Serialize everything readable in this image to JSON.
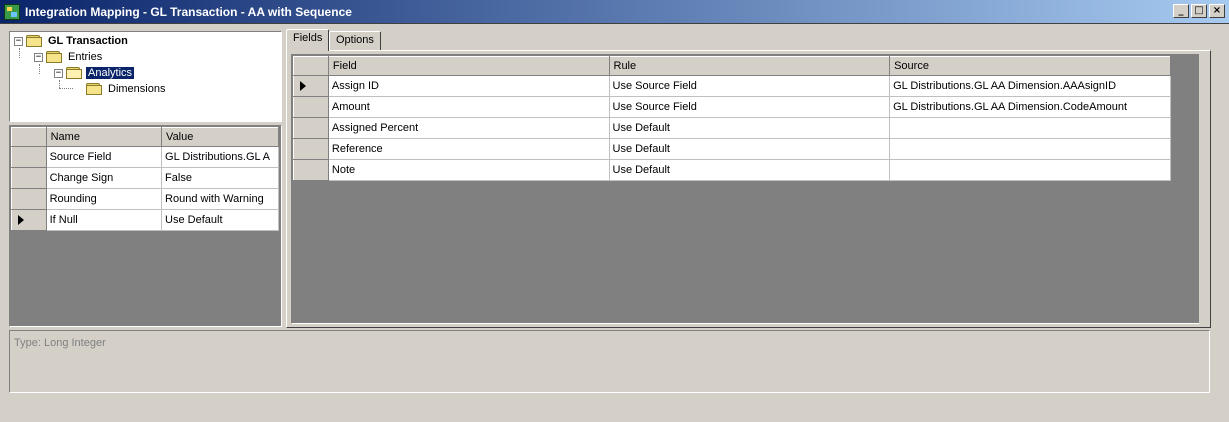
{
  "window": {
    "title": "Integration Mapping - GL Transaction - AA with Sequence",
    "minimize": "_",
    "maximize": "□",
    "close": "×"
  },
  "tree": {
    "items": [
      {
        "label": "GL Transaction",
        "icon": "folder-icon",
        "expanded": true
      },
      {
        "label": "Entries",
        "icon": "folder-icon",
        "expanded": true
      },
      {
        "label": "Analytics",
        "icon": "folder-open-icon",
        "expanded": true,
        "selected": true
      },
      {
        "label": "Dimensions",
        "icon": "folder-icon"
      }
    ]
  },
  "properties": {
    "columns": [
      "Name",
      "Value"
    ],
    "rows": [
      {
        "name": "Source Field",
        "value": "GL Distributions.GL A"
      },
      {
        "name": "Change Sign",
        "value": "False"
      },
      {
        "name": "Rounding",
        "value": "Round with Warning"
      },
      {
        "name": "If Null",
        "value": "Use Default",
        "current": true
      }
    ]
  },
  "tabs": [
    {
      "label": "Fields",
      "active": true
    },
    {
      "label": "Options",
      "active": false
    }
  ],
  "fields_grid": {
    "columns": [
      "Field",
      "Rule",
      "Source"
    ],
    "rows": [
      {
        "field": "Assign ID",
        "rule": "Use Source Field",
        "source": "GL Distributions.GL AA Dimension.AAAsignID",
        "current": true
      },
      {
        "field": "Amount",
        "rule": "Use Source Field",
        "source": "GL Distributions.GL AA Dimension.CodeAmount"
      },
      {
        "field": "Assigned Percent",
        "rule": "Use Default",
        "source": ""
      },
      {
        "field": "Reference",
        "rule": "Use Default",
        "source": ""
      },
      {
        "field": "Note",
        "rule": "Use Default",
        "source": ""
      }
    ]
  },
  "info": {
    "type_text": "Type: Long Integer"
  },
  "colors": {
    "titlebar_start": "#0a246a",
    "titlebar_end": "#a6caf0",
    "selection": "#0a246a",
    "face": "#d4d0c8",
    "grid_background": "#808080"
  }
}
